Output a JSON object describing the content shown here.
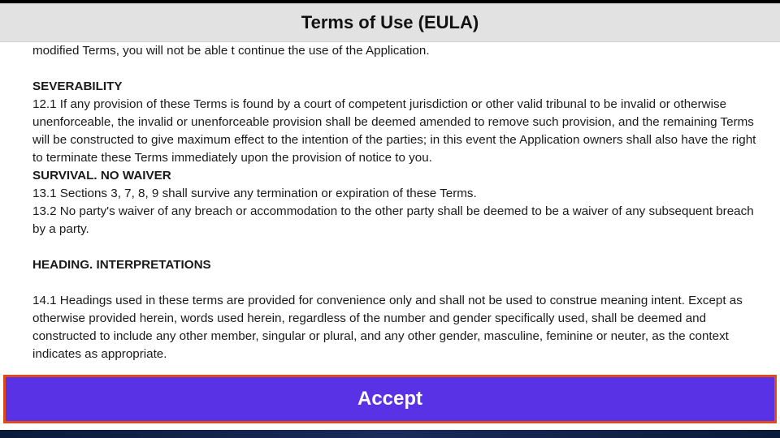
{
  "header": {
    "title": "Terms of Use (EULA)"
  },
  "body": {
    "partial_top": "modified Terms, you will not be able t continue the use of the Application.",
    "severability": {
      "head": "SEVERABILITY",
      "p1": "12.1 If any provision of these Terms is found by a court of competent jurisdiction or other valid tribunal to be invalid or otherwise unenforceable, the invalid or unenforceable provision shall be deemed amended to remove such provision, and the remaining Terms will be constructed to give maximum effect to the intention of the parties; in this event the Application owners shall also have the right to terminate these Terms immediately upon the provision of notice to you."
    },
    "survival": {
      "head": "SURVIVAL. NO WAIVER",
      "p1": "13.1 Sections 3, 7, 8, 9 shall survive any termination or expiration of these Terms.",
      "p2": "13.2 No party's waiver of any breach or accommodation to the other party shall be deemed to be a waiver of any subsequent breach by a party."
    },
    "heading_interp": {
      "head": "HEADING. INTERPRETATIONS",
      "p1": "14.1 Headings used in these terms are provided for convenience only and shall not be used to construe meaning intent. Except as otherwise provided herein, words used herein, regardless of the number and gender specifically used, shall be deemed and constructed to include any other member, singular or plural, and any other gender, masculine, feminine or neuter, as the context indicates as appropriate."
    }
  },
  "footer": {
    "accept_label": "Accept"
  },
  "colors": {
    "accent": "#5a32e6",
    "highlight_border": "#e04a1a",
    "header_bg": "#e2e2e2"
  }
}
